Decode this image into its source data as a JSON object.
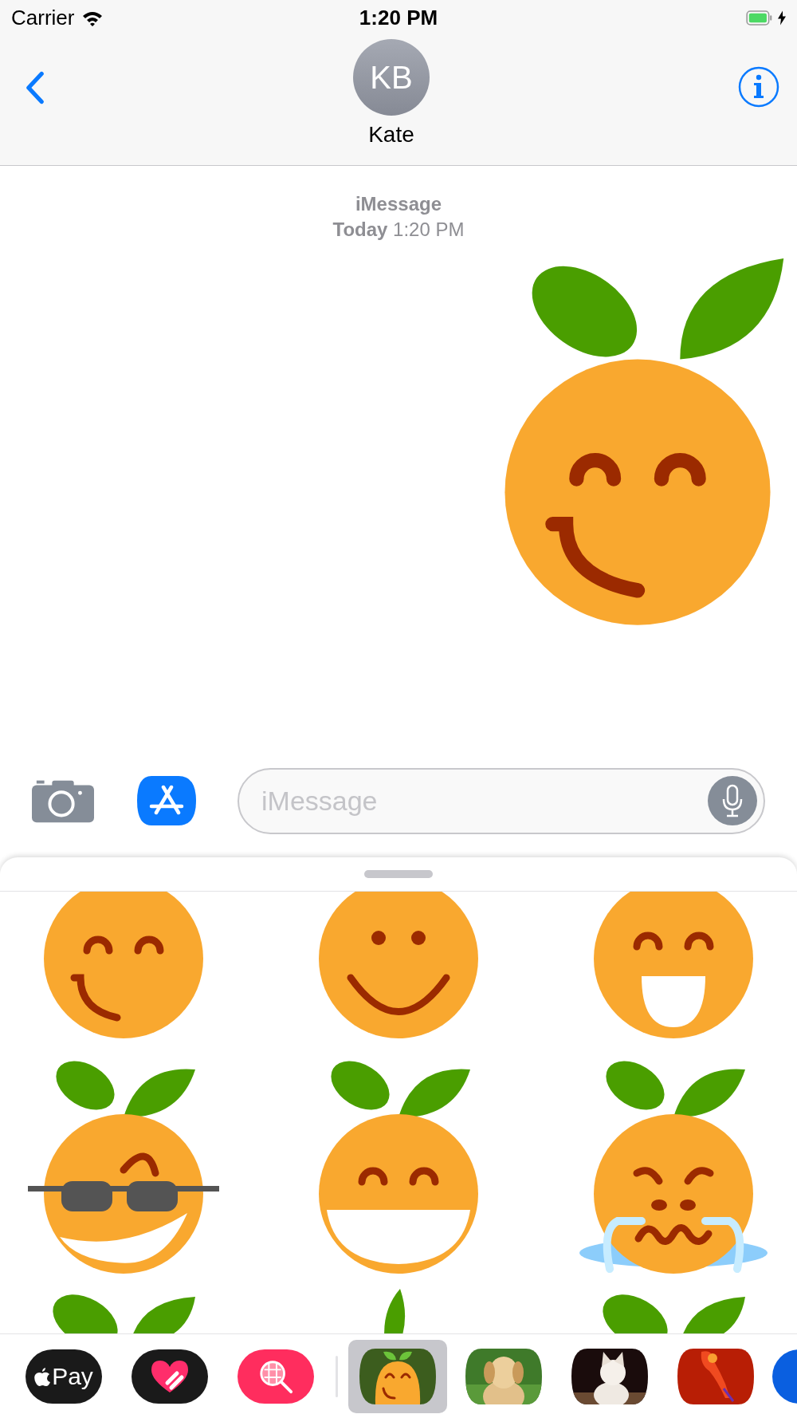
{
  "status_bar": {
    "carrier": "Carrier",
    "time": "1:20 PM"
  },
  "nav": {
    "initials": "KB",
    "name": "Kate"
  },
  "timestamp": {
    "service": "iMessage",
    "time": "**Today** 1:20 PM"
  },
  "sent_sticker": {
    "kind": "smirk"
  },
  "composer": {
    "placeholder": "iMessage"
  },
  "stickers": [
    {
      "kind": "smirk"
    },
    {
      "kind": "smile"
    },
    {
      "kind": "laugh"
    },
    {
      "kind": "cool"
    },
    {
      "kind": "grin"
    },
    {
      "kind": "cry"
    },
    {
      "kind": "partial"
    },
    {
      "kind": "partial"
    },
    {
      "kind": "partial"
    }
  ],
  "system_apps": [
    {
      "kind": "apple-pay",
      "label": "Pay",
      "selected": false
    },
    {
      "kind": "heart",
      "selected": false
    },
    {
      "kind": "search",
      "selected": false
    }
  ],
  "apps": [
    {
      "kind": "stickers",
      "selected": true
    },
    {
      "kind": "puppy",
      "selected": false
    },
    {
      "kind": "kitten",
      "selected": false
    },
    {
      "kind": "red",
      "selected": false
    },
    {
      "kind": "blue",
      "selected": false
    }
  ]
}
